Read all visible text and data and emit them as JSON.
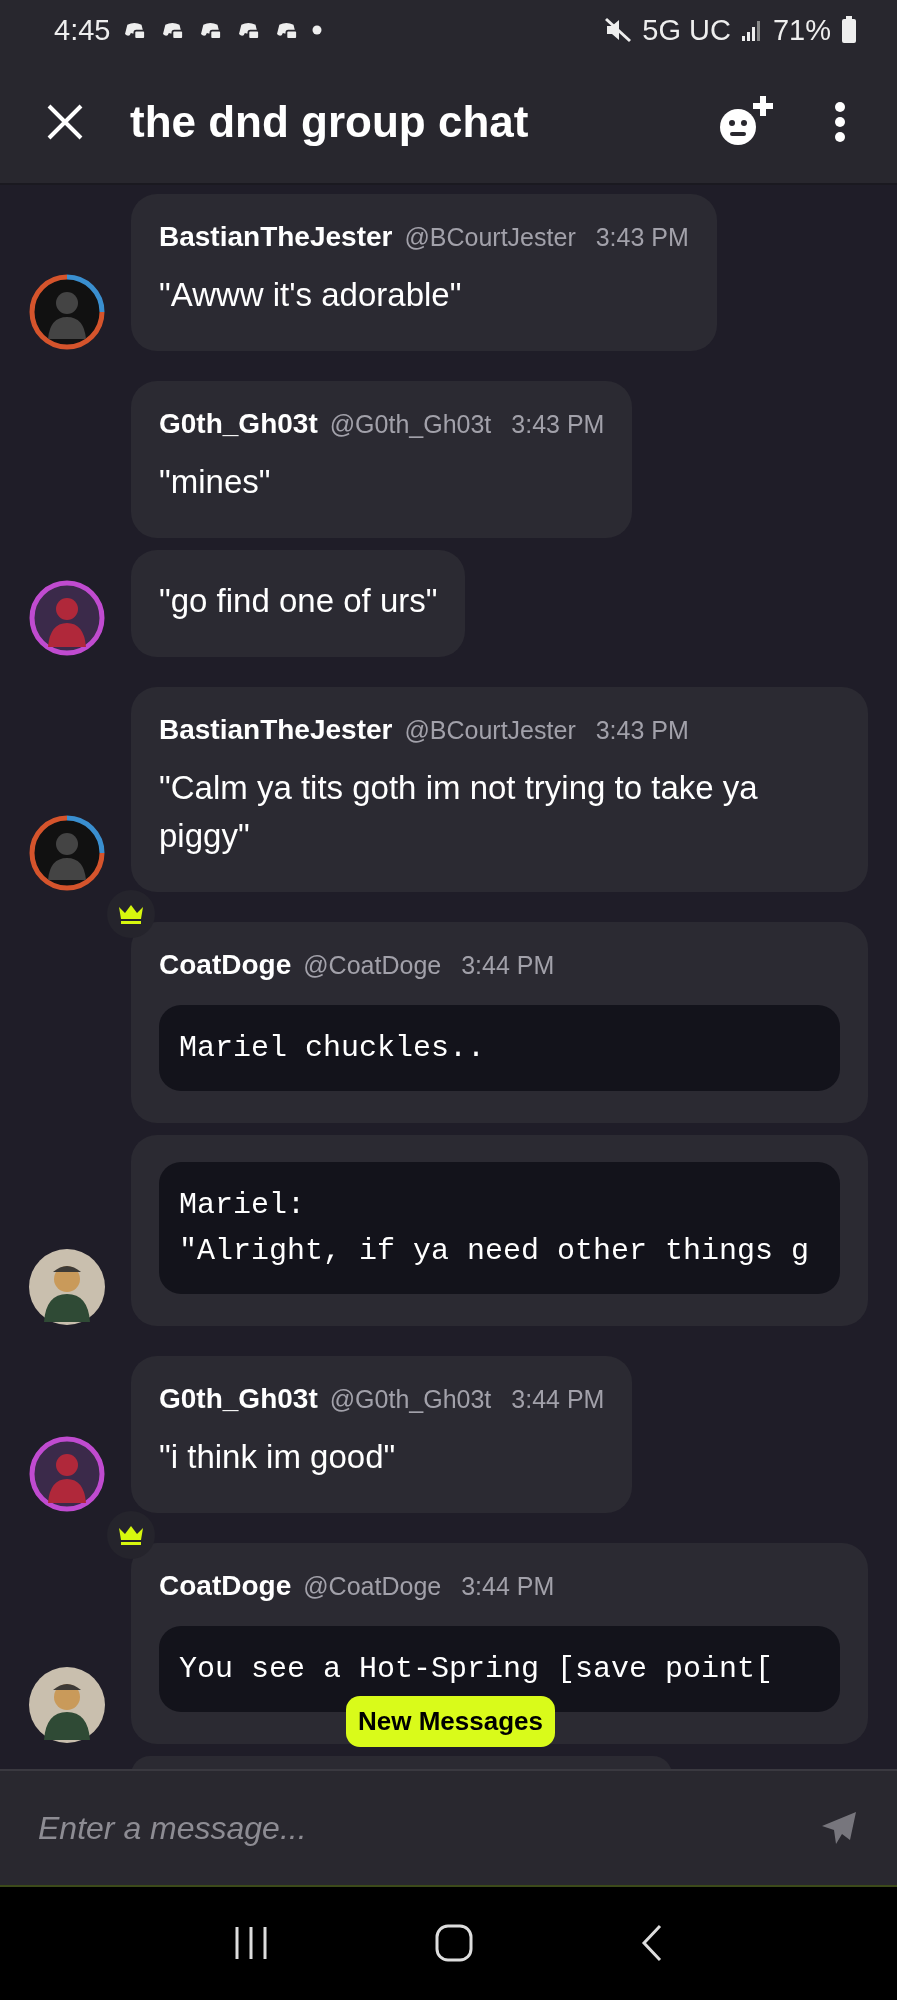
{
  "status_bar": {
    "time": "4:45",
    "network": "5G UC",
    "battery": "71%"
  },
  "header": {
    "title": "the dnd group chat"
  },
  "messages": [
    {
      "author": "BastianTheJester",
      "handle": "@BCourtJester",
      "time": "3:43 PM",
      "kind": "text",
      "lines": [
        "\"Awww it's adorable\""
      ],
      "avatar": {
        "kind": "orange-ring"
      },
      "crown": false
    },
    {
      "author": "G0th_Gh03t",
      "handle": "@G0th_Gh03t",
      "time": "3:43 PM",
      "kind": "text",
      "lines": [
        "\"mines\""
      ],
      "crown": false
    },
    {
      "kind": "text",
      "lines": [
        "\"go find one of urs\""
      ],
      "avatar": {
        "kind": "pink-ring"
      },
      "crown": false
    },
    {
      "author": "BastianTheJester",
      "handle": "@BCourtJester",
      "time": "3:43 PM",
      "kind": "text",
      "lines": [
        "\"Calm ya tits goth im not trying to take ya piggy\""
      ],
      "avatar": {
        "kind": "orange-ring"
      },
      "crown": false
    },
    {
      "author": "CoatDoge",
      "handle": "@CoatDoge",
      "time": "3:44 PM",
      "kind": "code",
      "lines": [
        "Mariel chuckles.."
      ],
      "crown": true
    },
    {
      "kind": "code",
      "lines": [
        "Mariel:",
        "\"Alright, if ya need other things g"
      ],
      "avatar": {
        "kind": "plain"
      },
      "crown": false
    },
    {
      "author": "G0th_Gh03t",
      "handle": "@G0th_Gh03t",
      "time": "3:44 PM",
      "kind": "text",
      "lines": [
        "\"i think im good\""
      ],
      "avatar": {
        "kind": "pink-ring"
      },
      "crown": false
    },
    {
      "author": "CoatDoge",
      "handle": "@CoatDoge",
      "time": "3:44 PM",
      "kind": "code",
      "lines": [
        "You see a Hot-Spring [save point["
      ],
      "avatar": {
        "kind": "plain"
      },
      "crown": true
    },
    {
      "kind": "partial"
    }
  ],
  "new_messages": {
    "label": "New Messages"
  },
  "composer": {
    "placeholder": "Enter a message..."
  }
}
